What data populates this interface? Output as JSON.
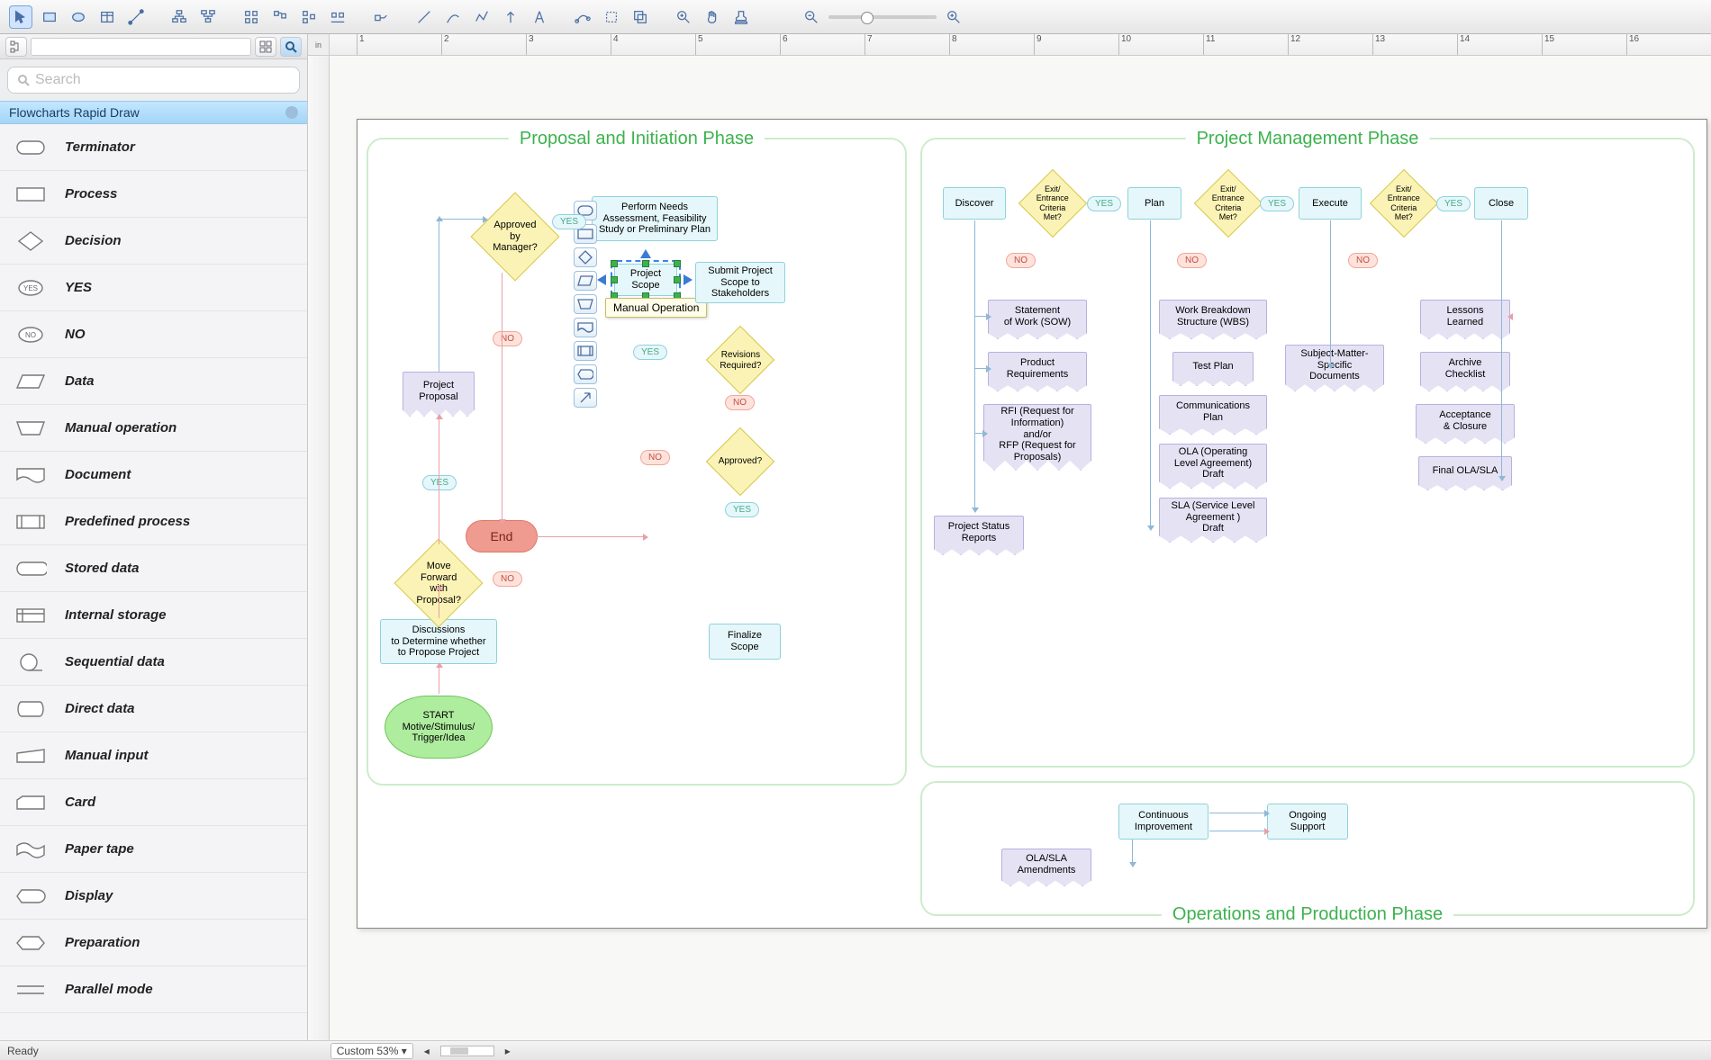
{
  "toolbar": {
    "unit_label": "in"
  },
  "sidebar": {
    "search_placeholder": "Search",
    "panel_title": "Flowcharts Rapid Draw",
    "shapes": [
      "Terminator",
      "Process",
      "Decision",
      "YES",
      "NO",
      "Data",
      "Manual operation",
      "Document",
      "Predefined process",
      "Stored data",
      "Internal storage",
      "Sequential data",
      "Direct data",
      "Manual input",
      "Card",
      "Paper tape",
      "Display",
      "Preparation",
      "Parallel mode"
    ]
  },
  "ruler_ticks": [
    "1",
    "2",
    "3",
    "4",
    "5",
    "6",
    "7",
    "8",
    "9",
    "10",
    "11",
    "12",
    "13",
    "14",
    "15",
    "16"
  ],
  "phases": {
    "proposal": "Proposal and Initiation Phase",
    "pm": "Project Management Phase",
    "ops": "Operations and Production Phase"
  },
  "nodes": {
    "start": "START\nMotive/Stimulus/\nTrigger/Idea",
    "discuss": "Discussions\nto Determine whether\nto Propose Project",
    "move_fwd": "Move Forward\nwith Proposal?",
    "proj_proposal": "Project\nProposal",
    "approved_mgr": "Approved by\nManager?",
    "end": "End",
    "perform_needs": "Perform Needs\nAssessment, Feasibility\nStudy or Preliminary Plan",
    "project_scope": "Project\nScope",
    "submit_scope": "Submit Project\nScope to\nStakeholders",
    "revisions": "Revisions\nRequired?",
    "approved": "Approved?",
    "finalize": "Finalize\nScope",
    "tooltip": "Manual Operation",
    "discover": "Discover",
    "exit1": "Exit/\nEntrance\nCriteria\nMet?",
    "plan": "Plan",
    "exit2": "Exit/\nEntrance\nCriteria\nMet?",
    "execute": "Execute",
    "exit3": "Exit/\nEntrance\nCriteria\nMet?",
    "close": "Close",
    "sow": "Statement\nof Work (SOW)",
    "prod_req": "Product\nRequirements",
    "rfi": "RFI (Request for\nInformation)\nand/or\nRFP (Request for\nProposals)",
    "status_reports": "Project Status\nReports",
    "wbs": "Work Breakdown\nStructure (WBS)",
    "test_plan": "Test Plan",
    "comm_plan": "Communications\nPlan",
    "ola_draft": "OLA (Operating\nLevel Agreement)\nDraft",
    "sla_draft": "SLA (Service Level\nAgreement )\nDraft",
    "sme_docs": "Subject-Matter-\nSpecific\nDocuments",
    "lessons": "Lessons\nLearned",
    "archive": "Archive\nChecklist",
    "accept": "Acceptance\n& Closure",
    "final_ola": "Final OLA/SLA",
    "cont_imp": "Continuous\nImprovement",
    "ongoing": "Ongoing\nSupport",
    "ola_amend": "OLA/SLA\nAmendments"
  },
  "yn": {
    "yes": "YES",
    "no": "NO"
  },
  "status": {
    "ready": "Ready",
    "zoom_mode": "Custom",
    "zoom_pct": "53%"
  }
}
